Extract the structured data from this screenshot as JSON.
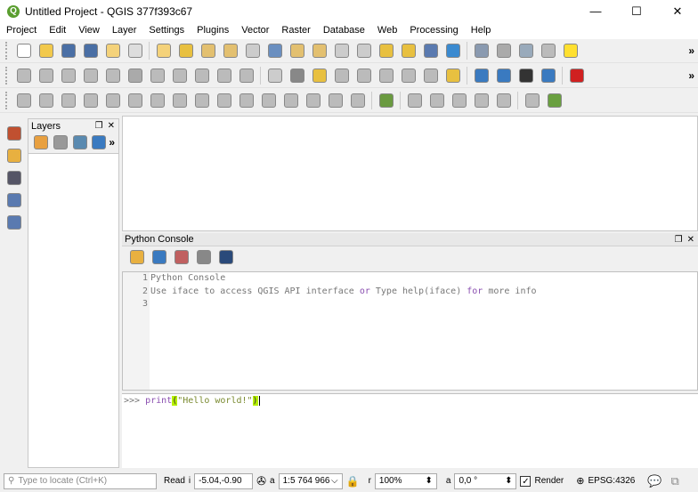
{
  "window": {
    "title": "Untitled Project - QGIS 377f393c67",
    "minimize": "—",
    "maximize": "☐",
    "close": "✕"
  },
  "menu": [
    "Project",
    "Edit",
    "View",
    "Layer",
    "Settings",
    "Plugins",
    "Vector",
    "Raster",
    "Database",
    "Web",
    "Processing",
    "Help"
  ],
  "toolbars": {
    "row1": [
      [
        "new-project",
        "#fff"
      ],
      [
        "open-project",
        "#f2c94c"
      ],
      [
        "save-project",
        "#4a6fa5"
      ],
      [
        "save-as",
        "#4a6fa5"
      ],
      [
        "new-print-layout",
        "#f4d27a"
      ],
      [
        "layout-manager",
        "#ddd"
      ],
      "|",
      [
        "pan",
        "#f4d27a"
      ],
      [
        "pan-to-selection",
        "#e8c040"
      ],
      [
        "zoom-in",
        "#e3c070"
      ],
      [
        "zoom-out",
        "#e3c070"
      ],
      [
        "zoom-native",
        "#ccc"
      ],
      [
        "zoom-full",
        "#6a8fc0"
      ],
      [
        "zoom-to-selection",
        "#e3c070"
      ],
      [
        "zoom-to-layer",
        "#e3c070"
      ],
      [
        "zoom-last",
        "#ccc"
      ],
      [
        "zoom-next",
        "#ccc"
      ],
      [
        "new-map-view",
        "#e8c040"
      ],
      [
        "new-3d-view",
        "#e8c040"
      ],
      [
        "temporal",
        "#5a7ab0"
      ],
      [
        "refresh",
        "#3a8ad0"
      ],
      "|",
      [
        "identify",
        "#8a9ab0"
      ],
      [
        "run-action",
        "#aaa"
      ],
      [
        "select",
        "#9ab"
      ],
      [
        "deselect",
        "#bbb"
      ],
      [
        "select-by-value",
        "#ffe030"
      ]
    ],
    "row2": [
      [
        "digitize",
        "#bbb"
      ],
      [
        "save-edits",
        "#bbb"
      ],
      [
        "add-feature",
        "#bbb"
      ],
      [
        "vertex-tool",
        "#bbb"
      ],
      [
        "edit-attributes",
        "#bbb"
      ],
      [
        "delete",
        "#aaa"
      ],
      [
        "cut",
        "#bbb"
      ],
      [
        "copy",
        "#bbb"
      ],
      [
        "paste",
        "#bbb"
      ],
      [
        "undo",
        "#bbb"
      ],
      [
        "redo",
        "#bbb"
      ],
      "|",
      [
        "label",
        "#ccc"
      ],
      [
        "label-pin",
        "#888"
      ],
      [
        "label-highlight",
        "#e8c040"
      ],
      [
        "label-move",
        "#bbb"
      ],
      [
        "label-rotate",
        "#bbb"
      ],
      [
        "label-change",
        "#bbb"
      ],
      [
        "label-show-hide",
        "#bbb"
      ],
      [
        "label-diagram",
        "#bbb"
      ],
      [
        "easy-label",
        "#e8c040"
      ],
      "|",
      [
        "metasearch",
        "#3a7ac0"
      ],
      [
        "wms",
        "#3a7ac0"
      ],
      [
        "globe",
        "#333"
      ],
      [
        "python",
        "#3a7ac0"
      ],
      "|",
      [
        "magnet",
        "#d02020"
      ]
    ],
    "row3": [
      [
        "measure",
        "#bbb"
      ],
      [
        "offset-curve",
        "#bbb"
      ],
      [
        "reshape",
        "#bbb"
      ],
      [
        "split",
        "#bbb"
      ],
      [
        "merge",
        "#bbb"
      ],
      [
        "rotate",
        "#bbb"
      ],
      [
        "simplify",
        "#bbb"
      ],
      [
        "add-ring",
        "#bbb"
      ],
      [
        "add-part",
        "#bbb"
      ],
      [
        "fill-ring",
        "#bbb"
      ],
      [
        "delete-ring",
        "#bbb"
      ],
      [
        "delete-part",
        "#bbb"
      ],
      [
        "split-parts",
        "#bbb"
      ],
      [
        "merge-attributes",
        "#bbb"
      ],
      [
        "rotate-point",
        "#bbb"
      ],
      [
        "offset-point",
        "#bbb"
      ],
      "|",
      [
        "profile",
        "#6a9a40"
      ],
      "|",
      [
        "circular-string",
        "#bbb"
      ],
      [
        "circle",
        "#bbb"
      ],
      [
        "ellipse",
        "#bbb"
      ],
      [
        "rectangle",
        "#bbb"
      ],
      [
        "polygon",
        "#bbb"
      ],
      "|",
      [
        "graph",
        "#bbb"
      ],
      [
        "plugin",
        "#6aa040"
      ]
    ]
  },
  "left_toolbar": [
    [
      "add-vector-layer",
      "#c05030"
    ],
    [
      "add-raster-layer",
      "#e8b040"
    ],
    [
      "add-delimited-text",
      "#556"
    ],
    [
      "add-virtual-layer",
      "#5a7ab0"
    ],
    [
      "add-wms-layer",
      "#5a7ab0"
    ]
  ],
  "layers_panel": {
    "title": "Layers",
    "tools": [
      [
        "open-styling",
        "#e8a040"
      ],
      [
        "add-group",
        "#999"
      ],
      [
        "filter-legend",
        "#5a8ab0"
      ],
      [
        "filter-expression",
        "#3a7ac0"
      ]
    ]
  },
  "console": {
    "title": "Python Console",
    "tools": [
      [
        "clear-console",
        "#e8b040"
      ],
      [
        "run-command",
        "#3a7ac0"
      ],
      [
        "show-editor",
        "#c06060"
      ],
      [
        "settings",
        "#888"
      ],
      [
        "help",
        "#2a4a7a"
      ]
    ],
    "lines": [
      "1",
      "2",
      "3"
    ],
    "line1": "Python Console",
    "line2": {
      "a": "Use iface to access QGIS API interface ",
      "b": "or",
      "c": " Type help(iface) ",
      "d": "for",
      "e": " more info"
    },
    "prompt": ">>> ",
    "cmd_fn": "print",
    "paren_open": "(",
    "cmd_str": "\"Hello world!\"",
    "paren_close": ")"
  },
  "statusbar": {
    "locate_placeholder": "Type to locate (Ctrl+K)",
    "coord_label": "Read",
    "coord_label_short": "i",
    "coordinate": "-5.04,-0.90",
    "scale_label": "a",
    "scale": "1:5 764 966",
    "mag_label": "r",
    "magnifier": "100%",
    "rot_label": "a",
    "rotation": "0,0 °",
    "render_label": "Render",
    "render_checked": true,
    "crs": "EPSG:4326"
  }
}
